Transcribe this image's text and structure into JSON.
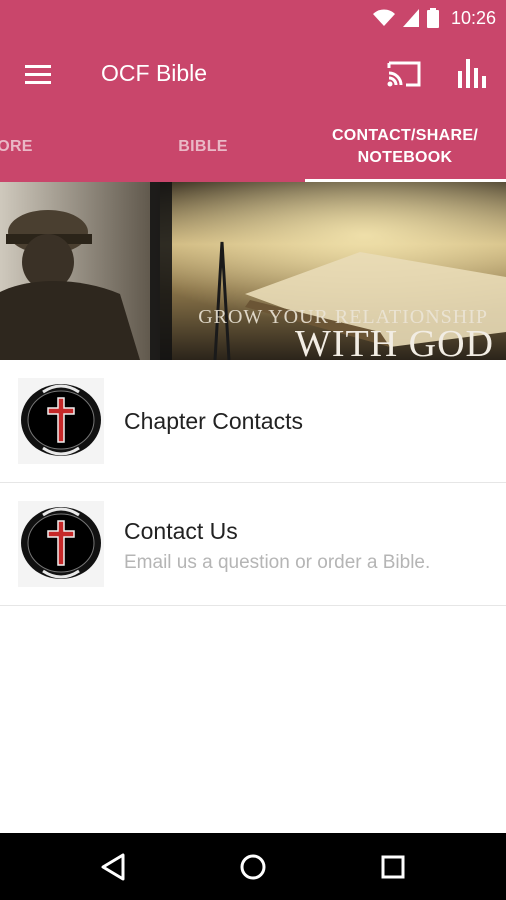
{
  "status_bar": {
    "time": "10:26",
    "icons": [
      "wifi-icon",
      "signal-icon",
      "battery-icon"
    ]
  },
  "app_bar": {
    "title": "OCF Bible",
    "icons": [
      "menu-icon",
      "cast-icon",
      "stats-icon"
    ]
  },
  "tabs": [
    {
      "label": "ORE"
    },
    {
      "label": "BIBLE"
    },
    {
      "label": "CONTACT/SHARE/ NOTEBOOK"
    }
  ],
  "banner": {
    "line1": "GROW YOUR RELATIONSHIP",
    "line2": "WITH GOD"
  },
  "list": [
    {
      "title": "Chapter Contacts",
      "subtitle": ""
    },
    {
      "title": "Contact Us",
      "subtitle": "Email us a question or order a Bible."
    }
  ],
  "nav_bar": {
    "icons": [
      "back-icon",
      "home-icon",
      "recents-icon"
    ]
  },
  "colors": {
    "primary": "#c9466b",
    "nav": "#000000"
  }
}
